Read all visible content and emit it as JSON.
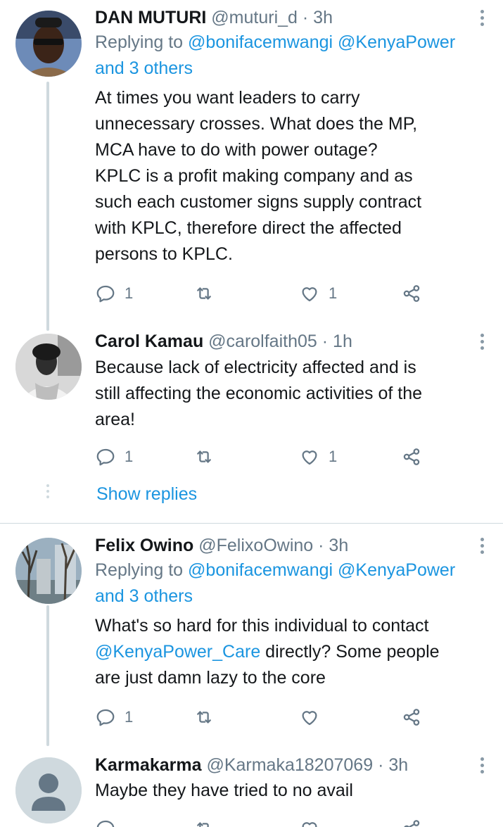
{
  "tweets": [
    {
      "name": "DAN MUTURI",
      "handle": "@muturi_d",
      "time": "· 3h",
      "replying_prefix": "Replying to ",
      "replying_user1": "@bonifacemwangi",
      "replying_user2": " @KenyaPower",
      "replying_others": "and 3 others",
      "text_lines": [
        "At times you want leaders to carry",
        "unnecessary crosses. What does the MP,",
        "MCA have to do with power outage?",
        "KPLC is a profit making company and as",
        "such each customer signs supply  contract",
        "with KPLC, therefore direct the affected",
        "persons to KPLC."
      ],
      "reply_count": "1",
      "retweet_count": "",
      "like_count": "1"
    },
    {
      "name": "Carol Kamau",
      "handle": "@carolfaith05",
      "time": "· 1h",
      "text_lines": [
        "Because lack of electricity  affected and is",
        "still affecting the economic activities of the",
        "area!"
      ],
      "reply_count": "1",
      "retweet_count": "",
      "like_count": "1"
    },
    {
      "name": "Felix Owino",
      "handle": "@FelixoOwino",
      "time": "· 3h",
      "replying_prefix": "Replying to ",
      "replying_user1": "@bonifacemwangi",
      "replying_user2": " @KenyaPower",
      "replying_others": "and 3 others",
      "text_line1_prefix": "What's so hard for this individual to contact",
      "text_line2_mention": "@KenyaPower_Care",
      "text_line2_suffix": " directly? Some people",
      "text_line3": "are just damn lazy to the core",
      "reply_count": "1",
      "retweet_count": "",
      "like_count": ""
    },
    {
      "name": "Karmakarma",
      "handle": "@Karmaka18207069",
      "time": "· 3h",
      "text": "Maybe they have tried to no avail"
    }
  ],
  "show_replies": "Show replies",
  "colors": {
    "accent": "#1b95e0",
    "muted": "#657786",
    "text": "#14171a",
    "line": "#cfd9de"
  },
  "icons": [
    "more-vertical-icon",
    "reply-icon",
    "retweet-icon",
    "like-icon",
    "share-icon",
    "default-avatar-icon"
  ]
}
